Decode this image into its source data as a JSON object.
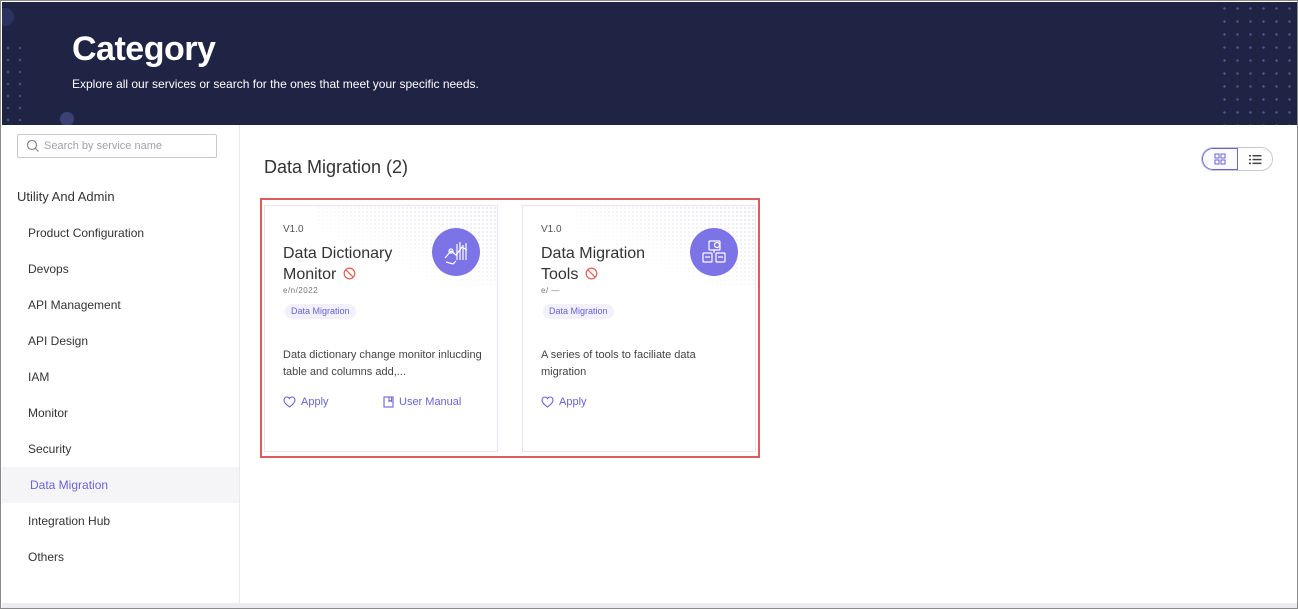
{
  "header": {
    "title": "Category",
    "subtitle": "Explore all our services or search for the ones that meet your specific needs."
  },
  "sidebar": {
    "search_placeholder": "Search by service name",
    "group_label": "Utility And Admin",
    "items": [
      {
        "label": "Product Configuration"
      },
      {
        "label": "Devops"
      },
      {
        "label": "API Management"
      },
      {
        "label": "API Design"
      },
      {
        "label": "IAM"
      },
      {
        "label": "Monitor"
      },
      {
        "label": "Security"
      },
      {
        "label": "Data Migration",
        "active": true
      },
      {
        "label": "Integration Hub"
      },
      {
        "label": "Others"
      }
    ]
  },
  "main": {
    "heading": "Data Migration (2)",
    "cards": [
      {
        "version": "V1.0",
        "title": "Data Dictionary Monitor",
        "subtitle": "e/n/2022",
        "tag": "Data Migration",
        "description": "Data dictionary change monitor inlucding table and columns add,...",
        "apply_label": "Apply",
        "manual_label": "User Manual",
        "icon": "chart-analytics-icon"
      },
      {
        "version": "V1.0",
        "title": "Data Migration Tools",
        "subtitle": "e/ —",
        "tag": "Data Migration",
        "description": "A series of tools to faciliate data migration",
        "apply_label": "Apply",
        "icon": "migration-tools-icon"
      }
    ]
  },
  "colors": {
    "header_bg": "#1f2344",
    "accent": "#6a62d8",
    "badge": "#7c74e6",
    "highlight": "#e05c5c"
  }
}
